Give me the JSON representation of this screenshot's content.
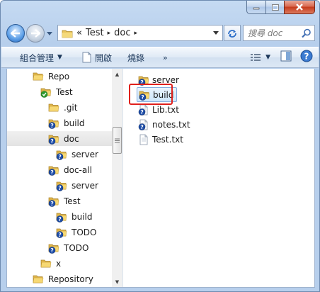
{
  "window": {
    "caption_buttons": [
      "minimize",
      "maximize",
      "close"
    ]
  },
  "address_bar": {
    "overflow_chevron": "«",
    "segments": [
      "Test",
      "doc"
    ],
    "separator": "▸"
  },
  "search": {
    "placeholder": "搜尋 doc"
  },
  "toolbar": {
    "organize": "組合管理",
    "open": "開啟",
    "burn": "燒錄",
    "more": "»"
  },
  "tree": [
    {
      "label": "Repo",
      "icon": "folder-icon",
      "indent": 0
    },
    {
      "label": "Test",
      "icon": "folder-ok-icon",
      "indent": 1
    },
    {
      "label": ".git",
      "icon": "folder-icon",
      "indent": 2
    },
    {
      "label": "build",
      "icon": "folder-unversioned-icon",
      "indent": 2
    },
    {
      "label": "doc",
      "icon": "folder-unversioned-icon",
      "indent": 2,
      "selected": true
    },
    {
      "label": "server",
      "icon": "folder-unversioned-icon",
      "indent": 3
    },
    {
      "label": "doc-all",
      "icon": "folder-unversioned-icon",
      "indent": 2
    },
    {
      "label": "server",
      "icon": "folder-unversioned-icon",
      "indent": 3
    },
    {
      "label": "Test",
      "icon": "folder-unversioned-icon",
      "indent": 2
    },
    {
      "label": "build",
      "icon": "folder-unversioned-icon",
      "indent": 3
    },
    {
      "label": "TODO",
      "icon": "folder-unversioned-icon",
      "indent": 3
    },
    {
      "label": "TODO",
      "icon": "folder-unversioned-icon",
      "indent": 2
    },
    {
      "label": "x",
      "icon": "folder-icon",
      "indent": 1
    },
    {
      "label": "Repository",
      "icon": "folder-icon",
      "indent": 0
    }
  ],
  "files": [
    {
      "label": "server",
      "icon": "folder-unversioned-icon"
    },
    {
      "label": "build",
      "icon": "folder-unversioned-icon",
      "selected": true
    },
    {
      "label": "Lib.txt",
      "icon": "file-unversioned-icon"
    },
    {
      "label": "notes.txt",
      "icon": "file-unversioned-icon"
    },
    {
      "label": "Test.txt",
      "icon": "file-icon"
    }
  ],
  "colors": {
    "accent": "#1e395b",
    "highlight": "#e0201c",
    "unversioned": "#1f4ea8",
    "versioned_ok": "#2e9a2e"
  }
}
